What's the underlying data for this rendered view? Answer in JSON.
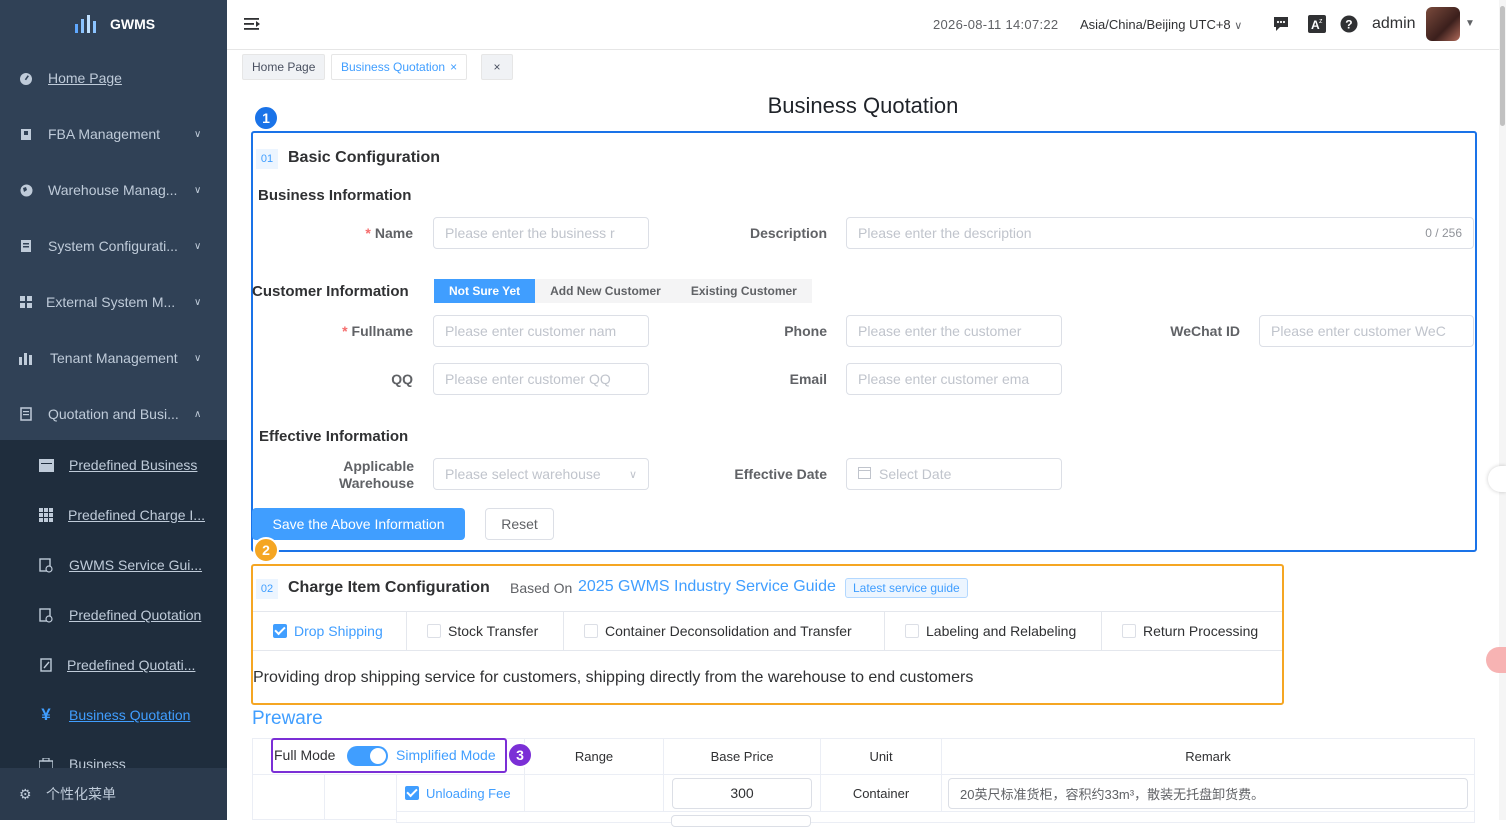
{
  "app": {
    "logo_text": "GWMS"
  },
  "sidebar": {
    "items": [
      {
        "label": "Home Page",
        "icon": "dashboard-icon"
      },
      {
        "label": "FBA Management",
        "icon": "box-icon"
      },
      {
        "label": "Warehouse Manag...",
        "icon": "globe-icon"
      },
      {
        "label": "System Configurati...",
        "icon": "settings-doc-icon"
      },
      {
        "label": "External System M...",
        "icon": "grid-icon"
      },
      {
        "label": "Tenant Management",
        "icon": "bar-chart-icon"
      },
      {
        "label": "Quotation and Busi...",
        "icon": "quotation-icon"
      }
    ],
    "sub_items": [
      {
        "label": "Predefined Business",
        "icon": "calendar-icon"
      },
      {
        "label": "Predefined Charge I...",
        "icon": "table-icon"
      },
      {
        "label": "GWMS Service Gui...",
        "icon": "doc-icon"
      },
      {
        "label": "Predefined Quotation",
        "icon": "doc-icon"
      },
      {
        "label": "Predefined Quotati...",
        "icon": "edit-doc-icon"
      },
      {
        "label": "Business Quotation",
        "icon": "yen-icon"
      },
      {
        "label": "Business",
        "icon": "briefcase-icon"
      }
    ],
    "footer": "个性化菜单"
  },
  "topbar": {
    "datetime": "2026-08-11 14:07:22",
    "timezone": "Asia/China/Beijing UTC+8",
    "user": "admin"
  },
  "tags": [
    {
      "label": "Home Page"
    },
    {
      "label": "Business Quotation"
    }
  ],
  "page_title": "Business Quotation",
  "callouts": [
    "1",
    "2",
    "3"
  ],
  "basic": {
    "no": "01",
    "title": "Basic Configuration",
    "business_info": "Business Information",
    "name_label": "Name",
    "name_placeholder": "Please enter the business r",
    "description_label": "Description",
    "description_placeholder": "Please enter the description",
    "description_count": "0 / 256",
    "customer_info": "Customer Information",
    "customer_options": [
      "Not Sure Yet",
      "Add New Customer",
      "Existing Customer"
    ],
    "fullname_label": "Fullname",
    "fullname_placeholder": "Please enter customer nam",
    "phone_label": "Phone",
    "phone_placeholder": "Please enter the customer",
    "wechat_label": "WeChat ID",
    "wechat_placeholder": "Please enter customer WeC",
    "qq_label": "QQ",
    "qq_placeholder": "Please enter customer QQ",
    "email_label": "Email",
    "email_placeholder": "Please enter customer ema",
    "effective_info": "Effective Information",
    "warehouse_label_1": "Applicable",
    "warehouse_label_2": "Warehouse",
    "warehouse_placeholder": "Please select warehouse",
    "date_label": "Effective Date",
    "date_placeholder": "Select Date",
    "save_button": "Save the Above Information",
    "reset_button": "Reset"
  },
  "charge": {
    "no": "02",
    "title": "Charge Item Configuration",
    "based_on": "Based On",
    "guide_link": "2025 GWMS Industry Service Guide",
    "guide_tag": "Latest service guide",
    "tabs": [
      {
        "label": "Drop Shipping",
        "checked": true
      },
      {
        "label": "Stock Transfer",
        "checked": false
      },
      {
        "label": "Container Deconsolidation and Transfer",
        "checked": false
      },
      {
        "label": "Labeling and Relabeling",
        "checked": false
      },
      {
        "label": "Return Processing",
        "checked": false
      }
    ],
    "description": "Providing drop shipping service for customers, shipping directly from the warehouse to end customers"
  },
  "preware": {
    "title": "Preware",
    "full_mode": "Full Mode",
    "simplified_mode": "Simplified Mode",
    "headers": [
      "Range",
      "Base Price",
      "Unit",
      "Remark"
    ],
    "row": {
      "label": "Unloading Fee",
      "price": "300",
      "unit": "Container",
      "remark": "20英尺标准货柜，容积约33m³，散装无托盘卸货费。"
    }
  },
  "colors": {
    "sidebar": "#304156",
    "primary": "#409eff",
    "callout1": "#1a73e8",
    "callout2": "#f5a623",
    "callout3": "#7b2fd6"
  }
}
